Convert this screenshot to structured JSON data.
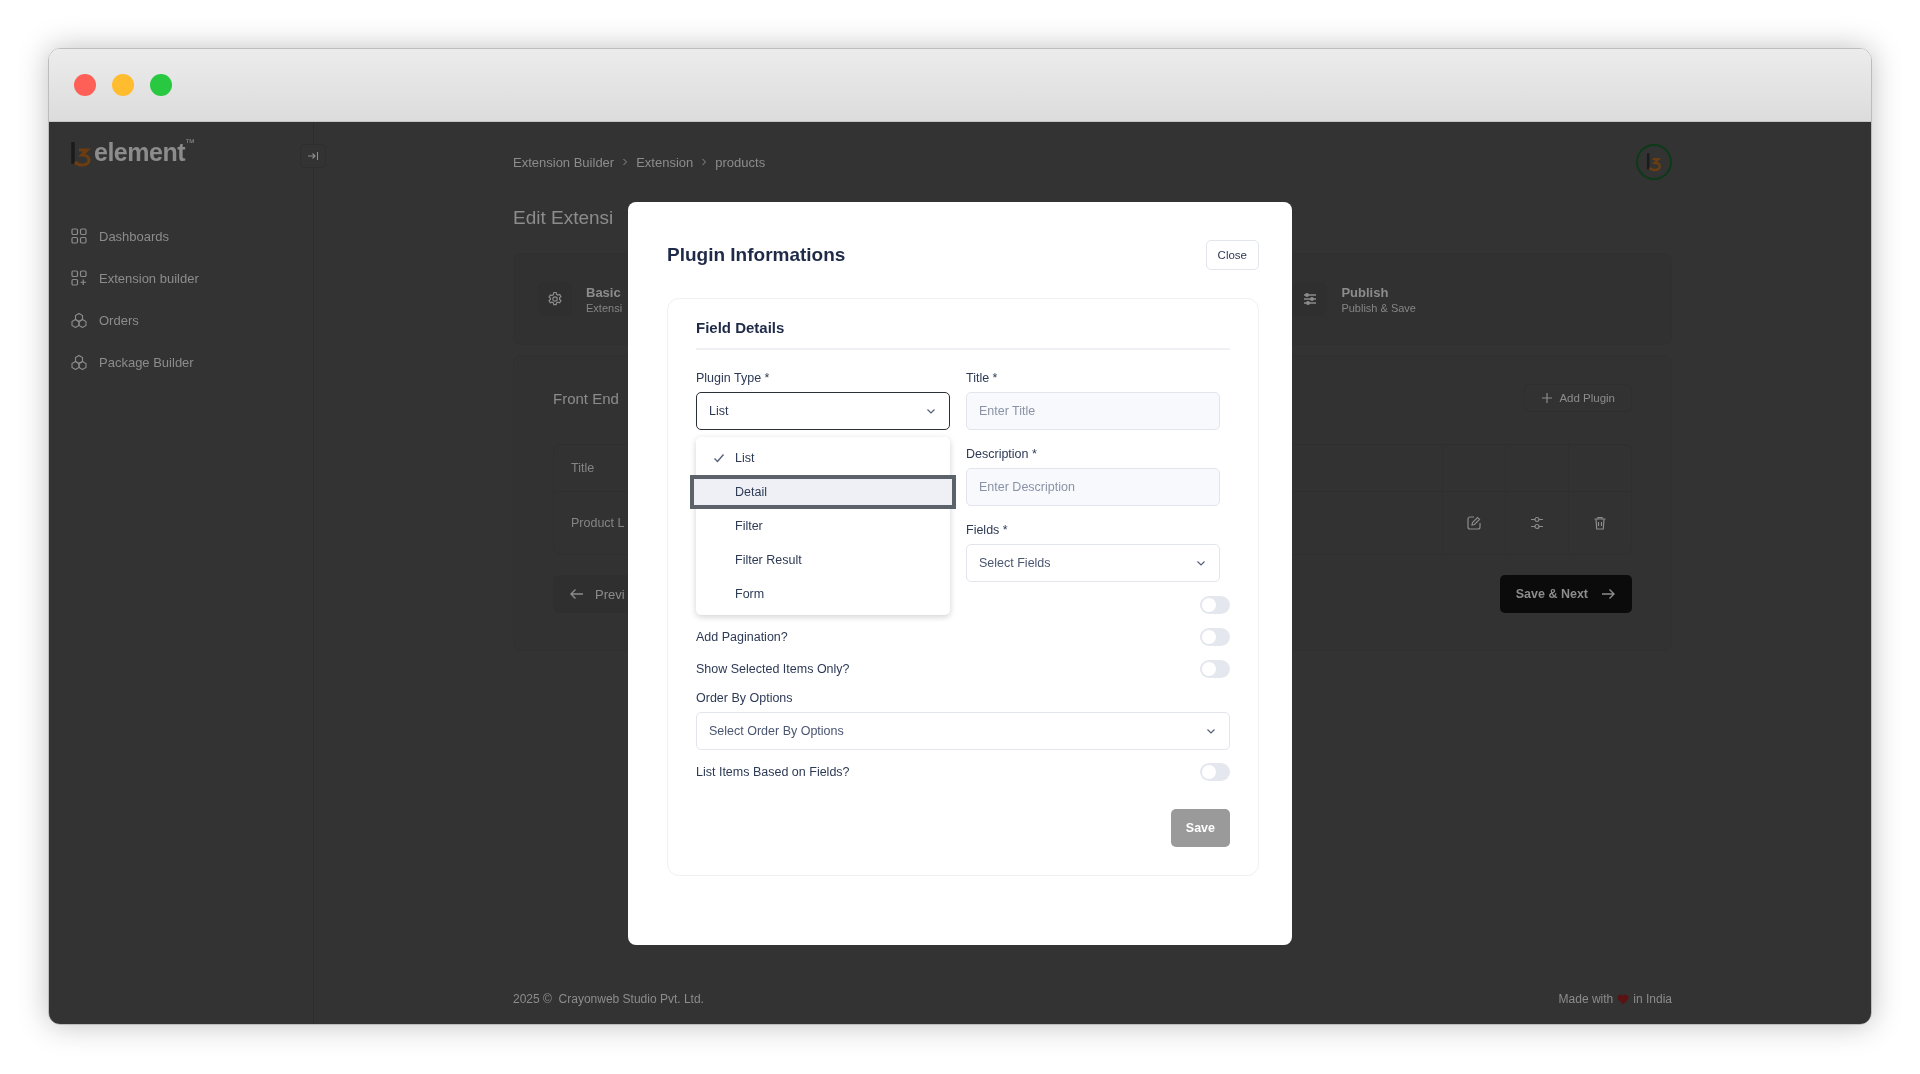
{
  "window": {
    "controls": [
      {
        "color": "#fe5f57"
      },
      {
        "color": "#febc2e"
      },
      {
        "color": "#28c840"
      }
    ]
  },
  "sidebar": {
    "logo": {
      "text": "element",
      "mark": "™"
    },
    "items": [
      {
        "label": "Dashboards"
      },
      {
        "label": "Extension builder"
      },
      {
        "label": "Orders"
      },
      {
        "label": "Package Builder"
      }
    ]
  },
  "breadcrumb": [
    "Extension Builder",
    "Extension",
    "products"
  ],
  "page_title": "Edit Extensi",
  "steps": [
    {
      "title": "Basic",
      "subtitle": "Extensi"
    },
    {
      "title": "Publish",
      "subtitle": "Publish & Save"
    }
  ],
  "plugins": {
    "title": "Front End",
    "add_button": "Add Plugin",
    "columns": [
      "Title"
    ],
    "rows": [
      [
        "Product L"
      ]
    ],
    "previous_button": "Previ",
    "next_button": "Save & Next"
  },
  "footer": {
    "copyright": "2025 ©  Crayonweb Studio Pvt. Ltd.",
    "made_with": "Made with",
    "made_in": "in India"
  },
  "modal": {
    "title": "Plugin Informations",
    "close_button": "Close",
    "section_title": "Field Details",
    "plugin_type": {
      "label": "Plugin Type *",
      "value": "List",
      "expanded": true,
      "options": [
        {
          "label": "List",
          "selected": true,
          "highlighted": false
        },
        {
          "label": "Detail",
          "selected": false,
          "highlighted": true
        },
        {
          "label": "Filter",
          "selected": false,
          "highlighted": false
        },
        {
          "label": "Filter Result",
          "selected": false,
          "highlighted": false
        },
        {
          "label": "Form",
          "selected": false,
          "highlighted": false
        }
      ]
    },
    "fields": [
      {
        "kind": "input",
        "label": "Title *",
        "placeholder": "Enter Title"
      },
      {
        "kind": "input",
        "label": "Description *",
        "placeholder": "Enter Description"
      },
      {
        "kind": "select",
        "label": "Fields *",
        "placeholder": "Select Fields"
      }
    ],
    "rows": [
      {
        "kind": "toggle",
        "on": false
      },
      {
        "kind": "toggle",
        "label": "Add Pagination?",
        "on": false
      },
      {
        "kind": "toggle",
        "label": "Show Selected Items Only?",
        "on": false
      },
      {
        "kind": "select",
        "label": "Order By Options",
        "placeholder": "Select Order By Options"
      },
      {
        "kind": "toggle",
        "label": "List Items Based on Fields?",
        "on": false
      }
    ],
    "save_button": "Save",
    "save_disabled": true
  }
}
